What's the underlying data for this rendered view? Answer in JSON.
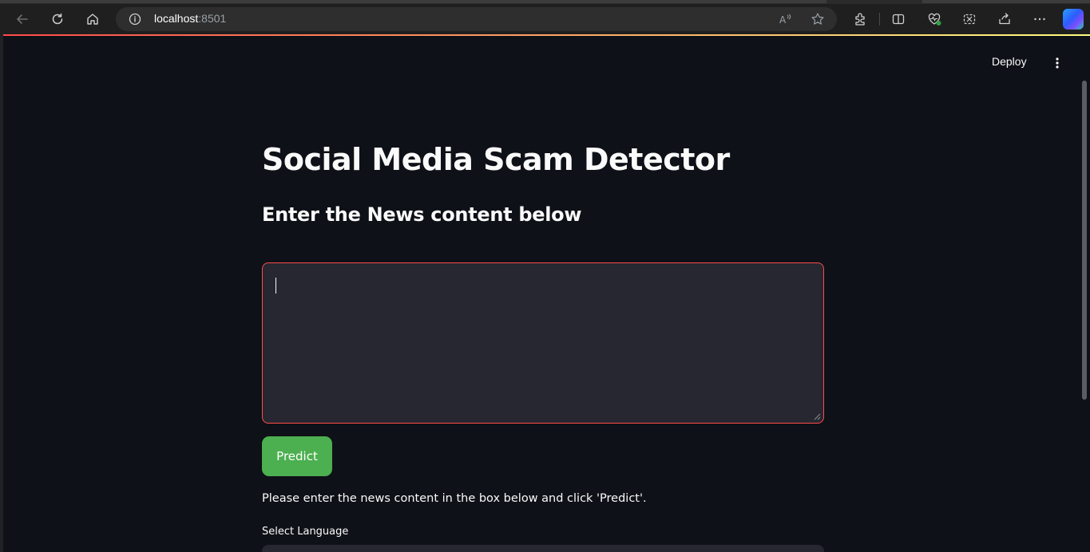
{
  "browser": {
    "url_host": "localhost",
    "url_port": ":8501",
    "icons": [
      "back-icon",
      "refresh-icon",
      "home-icon",
      "info-icon",
      "read-aloud-icon",
      "favorite-star-icon",
      "extensions-icon",
      "split-screen-icon",
      "browser-essentials-icon",
      "web-capture-icon",
      "share-icon",
      "more-icon",
      "copilot-icon"
    ]
  },
  "app": {
    "deploy_label": "Deploy",
    "title": "Social Media Scam Detector",
    "subtitle": "Enter the News content below",
    "news_input_value": "",
    "predict_label": "Predict",
    "instructions": "Please enter the news content in the box below and click 'Predict'.",
    "language_label": "Select Language",
    "colors": {
      "background": "#0e1117",
      "input_bg": "#262730",
      "input_border": "#ff4b4b",
      "button": "#4caf50"
    }
  }
}
